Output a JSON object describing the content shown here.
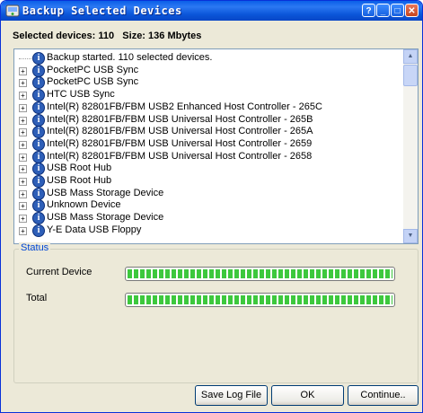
{
  "window": {
    "title": "Backup Selected Devices",
    "icon": "backup-icon",
    "controls": [
      "help-icon",
      "minimize-icon",
      "maximize-icon",
      "close-icon"
    ]
  },
  "summary": {
    "text": "Selected devices: 110   Size: 136 Mbytes"
  },
  "log_list": {
    "items": [
      {
        "label": "Backup started. 110 selected devices.",
        "expandable": false
      },
      {
        "label": "PocketPC USB Sync",
        "expandable": true
      },
      {
        "label": "PocketPC USB Sync",
        "expandable": true
      },
      {
        "label": "HTC USB Sync",
        "expandable": true
      },
      {
        "label": "Intel(R) 82801FB/FBM USB2 Enhanced Host Controller - 265C",
        "expandable": true
      },
      {
        "label": "Intel(R) 82801FB/FBM USB Universal Host Controller - 265B",
        "expandable": true
      },
      {
        "label": "Intel(R) 82801FB/FBM USB Universal Host Controller - 265A",
        "expandable": true
      },
      {
        "label": "Intel(R) 82801FB/FBM USB Universal Host Controller - 2659",
        "expandable": true
      },
      {
        "label": "Intel(R) 82801FB/FBM USB Universal Host Controller - 2658",
        "expandable": true
      },
      {
        "label": "USB Root Hub",
        "expandable": true
      },
      {
        "label": "USB Root Hub",
        "expandable": true
      },
      {
        "label": "USB Mass Storage Device",
        "expandable": true
      },
      {
        "label": "Unknown Device",
        "expandable": true
      },
      {
        "label": "USB Mass Storage Device",
        "expandable": true
      },
      {
        "label": "Y-E Data USB Floppy",
        "expandable": true
      }
    ]
  },
  "status": {
    "group_label": "Status",
    "current_device_label": "Current Device",
    "current_device_progress": 1.0,
    "total_label": "Total",
    "total_progress": 1.0,
    "progress_color": "#3dc83d"
  },
  "buttons": {
    "save_log": "Save Log File",
    "ok": "OK",
    "continue": "Continue.."
  }
}
